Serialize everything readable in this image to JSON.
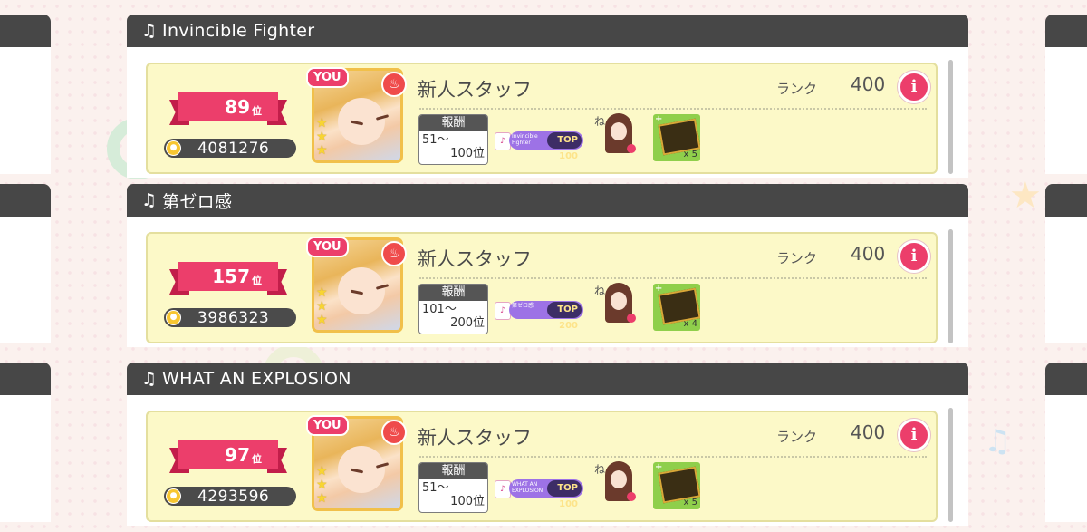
{
  "colors": {
    "header": "#474747",
    "ribbon": "#ec3e6b",
    "card": "#fcf9c8",
    "pill": "#9d72e6"
  },
  "panels": [
    {
      "song": "Invincible Fighter",
      "badge": "YOU",
      "rank": "89",
      "rank_suffix": "位",
      "score": "4081276",
      "player": "新人スタッフ",
      "rank_label": "ランク",
      "player_rank": "400",
      "reward_header": "報酬",
      "reward_range_top": "51〜",
      "reward_range_bottom": "100位",
      "song_badge": "Invincible Fighter",
      "top_badge": "TOP 100",
      "chara_label": "ね",
      "item_count": "x 5",
      "info_icon": "info-icon",
      "attr_icon": "fire-icon"
    },
    {
      "song": "第ゼロ感",
      "badge": "YOU",
      "rank": "157",
      "rank_suffix": "位",
      "score": "3986323",
      "player": "新人スタッフ",
      "rank_label": "ランク",
      "player_rank": "400",
      "reward_header": "報酬",
      "reward_range_top": "101〜",
      "reward_range_bottom": "200位",
      "song_badge": "第ゼロ感",
      "top_badge": "TOP 200",
      "chara_label": "ね",
      "item_count": "x 4",
      "info_icon": "info-icon",
      "attr_icon": "fire-icon"
    },
    {
      "song": "WHAT AN EXPLOSION",
      "badge": "YOU",
      "rank": "97",
      "rank_suffix": "位",
      "score": "4293596",
      "player": "新人スタッフ",
      "rank_label": "ランク",
      "player_rank": "400",
      "reward_header": "報酬",
      "reward_range_top": "51〜",
      "reward_range_bottom": "100位",
      "song_badge": "WHAT AN EXPLOSION",
      "top_badge": "TOP 100",
      "chara_label": "ね",
      "item_count": "x 5",
      "info_icon": "info-icon",
      "attr_icon": "fire-icon"
    }
  ]
}
